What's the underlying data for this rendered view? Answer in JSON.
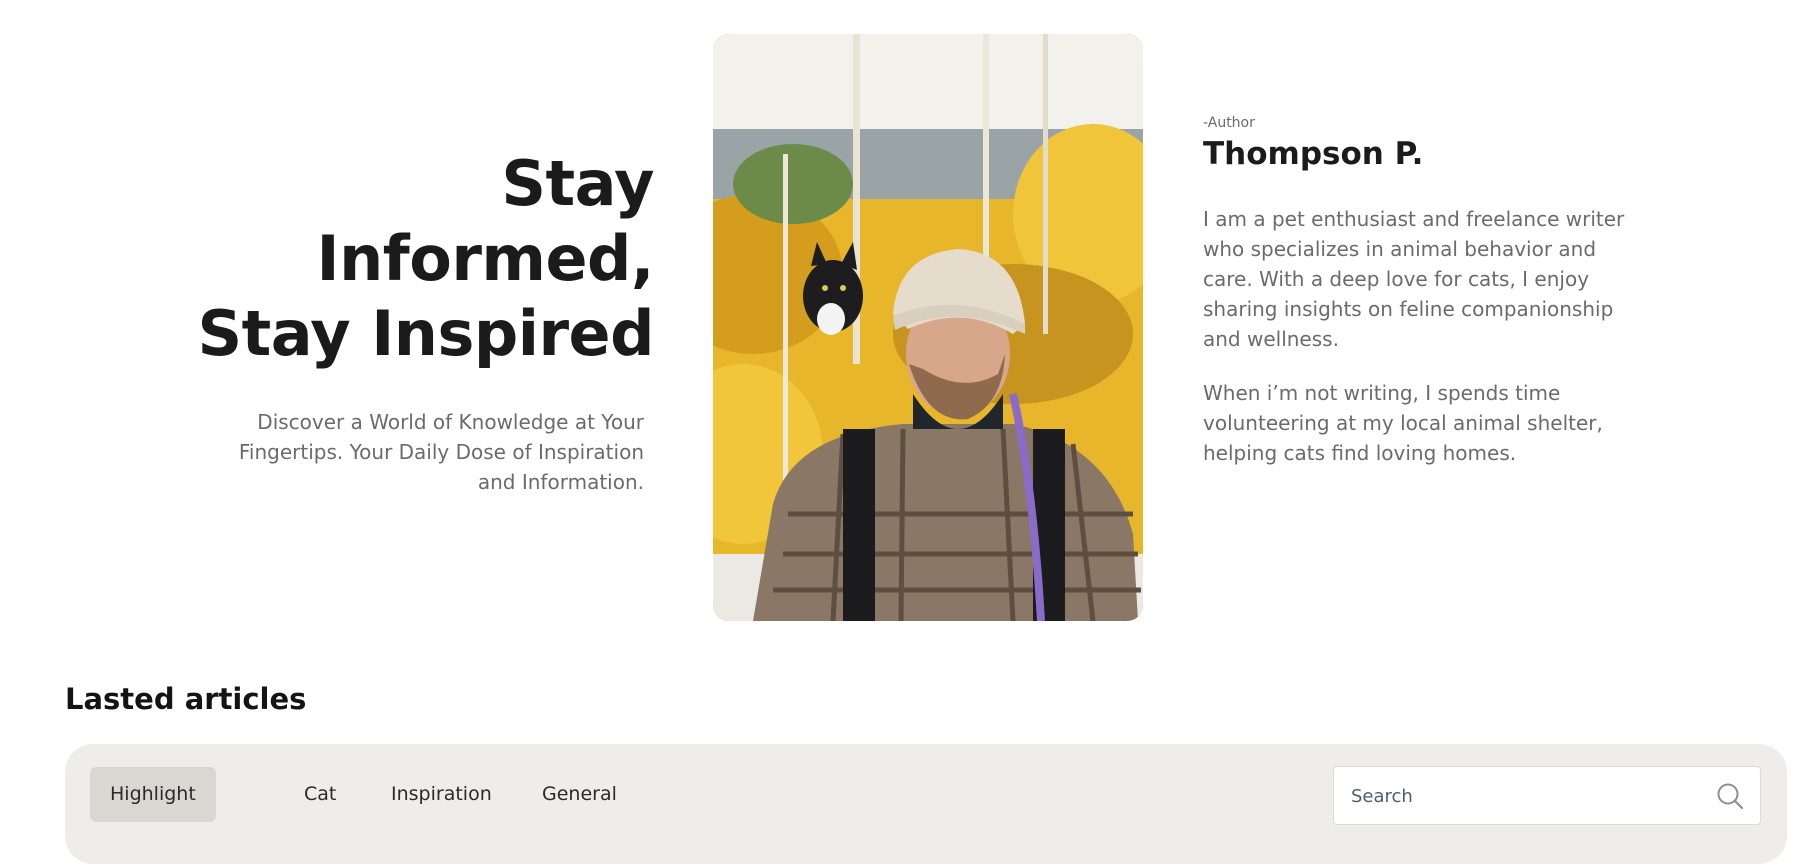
{
  "hero": {
    "title_lines": [
      "Stay",
      "Informed,",
      "Stay Inspired"
    ],
    "subtitle": "Discover a World of Knowledge at Your Fingertips. Your Daily Dose of Inspiration and Information."
  },
  "author": {
    "tag": "-Author",
    "name": "Thompson P.",
    "bio": [
      "I am a pet enthusiast and freelance writer who specializes in animal behavior and care. With a deep love for cats, I enjoy sharing insights on feline companionship and wellness.",
      "When i’m not writing, I spends time volunteering at my local animal shelter, helping cats find loving homes."
    ],
    "photo_icon": "author-photo"
  },
  "articles": {
    "section_title": "Lasted articles",
    "tabs": [
      {
        "label": "Highlight",
        "active": true
      },
      {
        "label": "Cat",
        "active": false
      },
      {
        "label": "Inspiration",
        "active": false
      },
      {
        "label": "General",
        "active": false
      }
    ],
    "search": {
      "placeholder": "Search",
      "value": "",
      "icon": "search-icon"
    }
  },
  "colors": {
    "text_dark": "#1b1b1b",
    "text_muted": "#6b6b6b",
    "filter_bar_bg": "#efede9",
    "active_tab_bg": "#dad7d2"
  }
}
